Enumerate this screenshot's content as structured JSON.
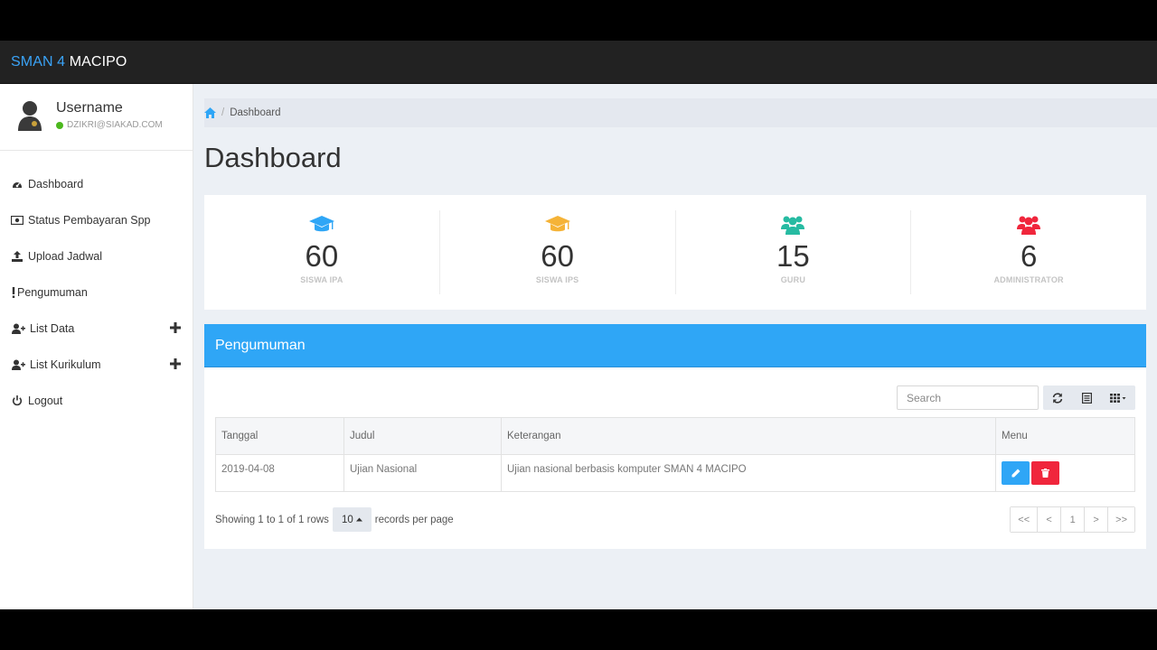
{
  "navbar": {
    "brand_part1": "SMAN 4 ",
    "brand_part2": "MACIPO"
  },
  "user": {
    "name": "Username",
    "email": "DZIKRI@SIAKAD.COM",
    "status_color": "#4cb81e"
  },
  "sidebar": {
    "items": [
      {
        "label": "Dashboard",
        "icon": "dashboard-icon",
        "expandable": false
      },
      {
        "label": "Status Pembayaran Spp",
        "icon": "money-icon",
        "expandable": false
      },
      {
        "label": "Upload Jadwal",
        "icon": "upload-icon",
        "expandable": false
      },
      {
        "label": "Pengumuman",
        "icon": "exclamation-icon",
        "expandable": false
      },
      {
        "label": "List Data",
        "icon": "user-plus-icon",
        "expandable": true
      },
      {
        "label": "List Kurikulum",
        "icon": "user-plus-icon",
        "expandable": true
      },
      {
        "label": "Logout",
        "icon": "power-icon",
        "expandable": false
      }
    ]
  },
  "breadcrumb": {
    "current": "Dashboard"
  },
  "page": {
    "title": "Dashboard"
  },
  "stats": [
    {
      "value": "60",
      "label": "SISWA IPA",
      "icon": "graduation-cap-icon",
      "color": "#2fa6f6"
    },
    {
      "value": "60",
      "label": "SISWA IPS",
      "icon": "graduation-cap-icon",
      "color": "#f5b337"
    },
    {
      "value": "15",
      "label": "GURU",
      "icon": "users-icon",
      "color": "#26bba2"
    },
    {
      "value": "6",
      "label": "ADMINISTRATOR",
      "icon": "users-icon",
      "color": "#f0263c"
    }
  ],
  "announcement": {
    "title": "Pengumuman",
    "search_placeholder": "Search",
    "columns": [
      "Tanggal",
      "Judul",
      "Keterangan",
      "Menu"
    ],
    "rows": [
      {
        "tanggal": "2019-04-08",
        "judul": "Ujian Nasional",
        "keterangan": "Ujian nasional berbasis komputer SMAN 4 MACIPO"
      }
    ],
    "footer": {
      "showing": "Showing 1 to 1 of 1 rows",
      "page_size": "10",
      "records_text": "records per page"
    },
    "pager": [
      "<<",
      "<",
      "1",
      ">",
      ">>"
    ]
  },
  "colors": {
    "primary": "#2fa6f6",
    "danger": "#f0263c",
    "navbar": "#222222"
  }
}
